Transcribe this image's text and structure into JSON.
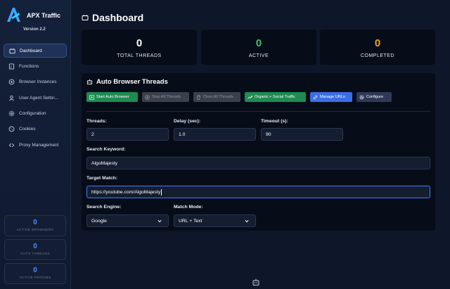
{
  "app": {
    "name": "APX Traffic",
    "version": "Version 2.2"
  },
  "sidebar": {
    "items": [
      {
        "label": "Dashboard",
        "icon": "dashboard-icon",
        "active": true
      },
      {
        "label": "Functions",
        "icon": "functions-icon",
        "active": false
      },
      {
        "label": "Browser Instances",
        "icon": "browser-icon",
        "active": false
      },
      {
        "label": "User Agent Settin...",
        "icon": "user-agent-icon",
        "active": false
      },
      {
        "label": "Configuration",
        "icon": "gear-icon",
        "active": false
      },
      {
        "label": "Cookies",
        "icon": "cookie-icon",
        "active": false
      },
      {
        "label": "Proxy Management",
        "icon": "proxy-icon",
        "active": false
      }
    ],
    "stats": [
      {
        "value": "0",
        "label": "ACTIVE BROWSERS"
      },
      {
        "value": "0",
        "label": "AUTO THREADS"
      },
      {
        "value": "0",
        "label": "ACTIVE PROXIES"
      }
    ]
  },
  "header": {
    "title": "Dashboard"
  },
  "stats": [
    {
      "value": "0",
      "label": "TOTAL THREADS",
      "color": "#ffffff"
    },
    {
      "value": "0",
      "label": "ACTIVE",
      "color": "#3fbf6e"
    },
    {
      "value": "0",
      "label": "COMPLETED",
      "color": "#f0a030"
    }
  ],
  "panel": {
    "title": "Auto Browser Threads",
    "buttons": {
      "start": "Start Auto Browser",
      "stop": "Stop All Threads",
      "clear": "Clear All Threads",
      "organic": "Organic + Social Traffic",
      "manage": "Manage URLs",
      "configure": "Configure"
    },
    "fields": {
      "threads": {
        "label": "Threads:",
        "value": "2"
      },
      "delay": {
        "label": "Delay (sec):",
        "value": "1.0"
      },
      "timeout": {
        "label": "Timeout (s):",
        "value": "90"
      },
      "keyword": {
        "label": "Search Keyword:",
        "value": "AlgoMajesty"
      },
      "target": {
        "label": "Target Match:",
        "value": "https://youtube.com/AlgoMajesty"
      },
      "engine": {
        "label": "Search Engine:",
        "value": "Google"
      },
      "mode": {
        "label": "Match Mode:",
        "value": "URL + Text"
      }
    }
  },
  "colors": {
    "accent": "#3d7bff",
    "success": "#1f8a52",
    "warning": "#f0a030"
  }
}
